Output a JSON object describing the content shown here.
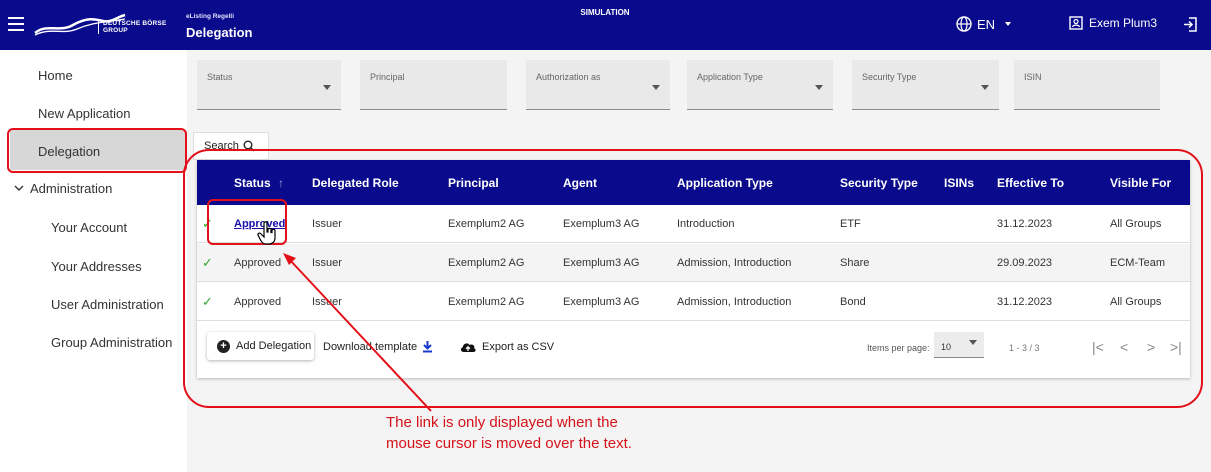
{
  "header": {
    "brand_line1": "DEUTSCHE BÖRSE",
    "brand_line2": "GROUP",
    "app_subtitle": "eListing Regelli",
    "page_title": "Delegation",
    "environment": "SIMULATION",
    "language": "EN",
    "user_name": "Exem Plum3",
    "background_color": "#0a0a8c"
  },
  "sidebar": {
    "home": "Home",
    "new_application": "New Application",
    "delegation": "Delegation",
    "administration": "Administration",
    "your_account": "Your Account",
    "your_addresses": "Your Addresses",
    "user_administration": "User Administration",
    "group_administration": "Group Administration"
  },
  "filters": {
    "status": "Status",
    "principal": "Principal",
    "authorization_as": "Authorization as",
    "application_type": "Application Type",
    "security_type": "Security Type",
    "isin": "ISIN"
  },
  "search_label": "Search",
  "table": {
    "columns": {
      "status": "Status",
      "sort_arrow": "↑",
      "delegated_role": "Delegated Role",
      "principal": "Principal",
      "agent": "Agent",
      "application_type": "Application Type",
      "security_type": "Security Type",
      "isins": "ISINs",
      "effective_to": "Effective To",
      "visible_for": "Visible For"
    },
    "rows": [
      {
        "status": "Approved",
        "role": "Issuer",
        "principal": "Exemplum2 AG",
        "agent": "Exemplum3 AG",
        "application_type": "Introduction",
        "security_type": "ETF",
        "isins": "",
        "effective_to": "31.12.2023",
        "visible_for": "All Groups"
      },
      {
        "status": "Approved",
        "role": "Issuer",
        "principal": "Exemplum2 AG",
        "agent": "Exemplum3 AG",
        "application_type": "Admission, Introduction",
        "security_type": "Share",
        "isins": "",
        "effective_to": "29.09.2023",
        "visible_for": "ECM-Team"
      },
      {
        "status": "Approved",
        "role": "Issuer",
        "principal": "Exemplum2 AG",
        "agent": "Exemplum3 AG",
        "application_type": "Admission, Introduction",
        "security_type": "Bond",
        "isins": "",
        "effective_to": "31.12.2023",
        "visible_for": "All Groups"
      }
    ]
  },
  "footer": {
    "add_delegation": "Add Delegation",
    "download_template": "Download template",
    "export_csv": "Export as CSV",
    "items_per_page_label": "Items per page:",
    "items_per_page_value": "10",
    "range": "1 - 3 / 3"
  },
  "annotation": {
    "line1": "The link is only displayed when the",
    "line2": "mouse cursor is moved over the text.",
    "color": "#e3101a"
  }
}
